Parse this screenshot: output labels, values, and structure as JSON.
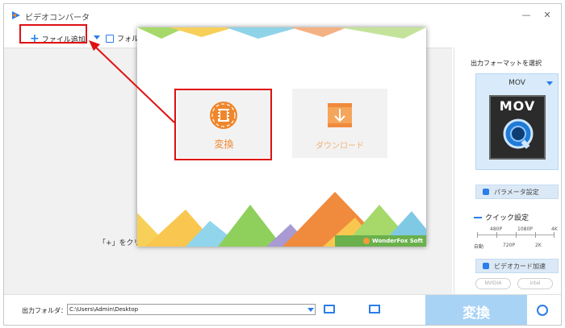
{
  "window": {
    "title": "ビデオコンバータ",
    "minimize_glyph": "—",
    "close_glyph": "✕"
  },
  "toolbar": {
    "add_file_label": "ファイル追加",
    "folder_label": "フォル"
  },
  "main": {
    "hint_text": "「+」をクリッ"
  },
  "popup": {
    "convert_label": "変換",
    "download_label": "ダウンロード",
    "brand_text": "WonderFox Soft"
  },
  "right_panel": {
    "title": "出力フォーマットを選択",
    "format_name": "MOV",
    "format_icon_text": "MOV",
    "param_button": "パラメータ設定",
    "quick_title": "クイック設定",
    "quick_top_labels": [
      "480P",
      "1080P",
      "4K"
    ],
    "quick_bottom_labels": [
      "自動",
      "720P",
      "2K"
    ],
    "gpu_button": "ビデオカード加速",
    "gpu_logos": [
      "NVIDIA",
      "intel"
    ]
  },
  "bottom": {
    "output_label": "出力フォルダ：",
    "output_path": "C:\\Users\\Admin\\Desktop",
    "convert_button": "変換"
  },
  "colors": {
    "accent": "#2b7de9",
    "highlight": "#e01010",
    "orange": "#f0862c",
    "convert_disabled": "#a9d3f5"
  }
}
